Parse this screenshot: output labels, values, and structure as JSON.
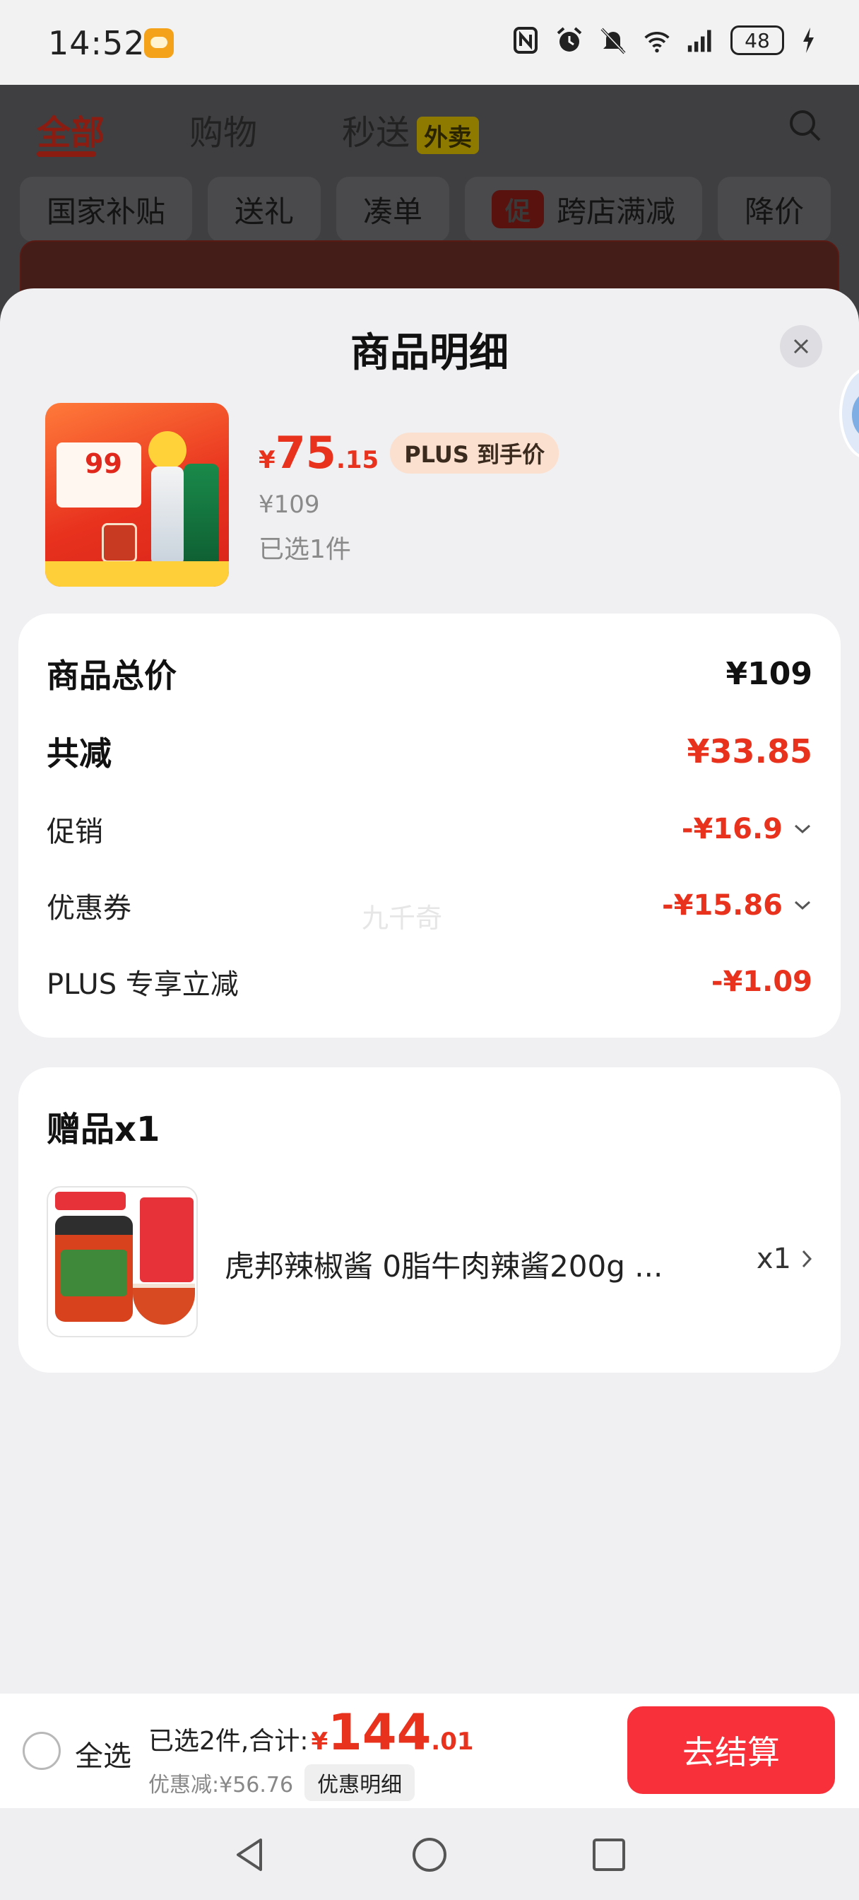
{
  "status_bar": {
    "time": "14:52",
    "battery": "48",
    "icons": [
      "nfc-icon",
      "alarm-icon",
      "mute-icon",
      "wifi-icon",
      "signal-icon",
      "battery-icon",
      "charging-icon"
    ]
  },
  "background_page": {
    "tabs": [
      "全部",
      "购物",
      "秒送"
    ],
    "tab_tag": "外卖",
    "chips": [
      "国家补贴",
      "送礼",
      "凑单",
      "跨店满减",
      "降价"
    ],
    "promo_mark": "促"
  },
  "sheet": {
    "title": "商品明细",
    "product": {
      "price_yen": "¥",
      "price_int": "75",
      "price_dec": ".15",
      "plus_badge": "PLUS 到手价",
      "original_price": "¥109",
      "selected": "已选1件",
      "image_text": "99"
    },
    "breakdown": {
      "total_label": "商品总价",
      "total_value": "¥109",
      "reduce_label": "共减",
      "reduce_value": "¥33.85",
      "items": [
        {
          "label": "促销",
          "value": "-¥16.9"
        },
        {
          "label": "优惠券",
          "value": "-¥15.86"
        },
        {
          "label": "PLUS 专享立减",
          "value": "-¥1.09"
        }
      ],
      "watermark": "九千奇"
    },
    "gift": {
      "title": "赠品x1",
      "name": "虎邦辣椒酱 0脂牛肉辣酱200g ...",
      "qty": "x1"
    }
  },
  "bottom_bar": {
    "select_all": "全选",
    "total_label": "已选2件,合计:",
    "total_yen": "¥",
    "total_int": "144",
    "total_dec": ".01",
    "discount": "优惠减:¥56.76",
    "detail_button": "优惠明细",
    "checkout": "去结算"
  },
  "colors": {
    "accent_red": "#e8321e",
    "checkout_red": "#f8303a",
    "plus_badge_bg": "#fbe0cf"
  }
}
